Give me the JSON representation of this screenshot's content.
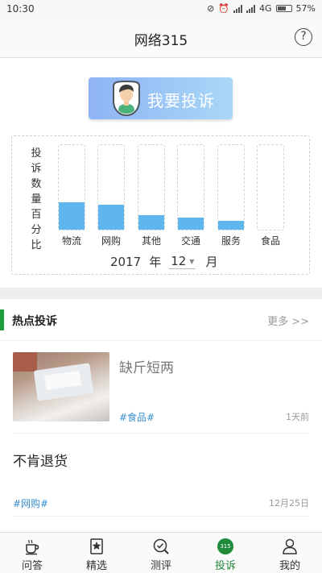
{
  "status_bar": {
    "time": "10:30",
    "network": "4G",
    "battery": "57%"
  },
  "header": {
    "title": "网络315",
    "help_icon": "question-circle-icon"
  },
  "complain_button": {
    "label": "我要投诉",
    "icon": "user-avatar-icon"
  },
  "chart": {
    "ylabel_chars": [
      "投",
      "诉",
      "数",
      "量",
      "百",
      "分",
      "比"
    ],
    "year": "2017",
    "year_unit": "年",
    "month": "12",
    "month_unit": "月"
  },
  "chart_data": {
    "type": "bar",
    "categories": [
      "物流",
      "网购",
      "其他",
      "交通",
      "服务",
      "食品"
    ],
    "values": [
      32,
      29,
      17,
      14,
      10,
      0
    ],
    "ylabel": "投诉数量百分比",
    "ylim": [
      0,
      100
    ],
    "grid": false,
    "bar_color": "#5fb6ec"
  },
  "hot": {
    "title": "热点投诉",
    "more": "更多 >>",
    "accent_color": "#1f9a3c",
    "items": [
      {
        "title": "缺斤短两",
        "tag": "#食品#",
        "time": "1天前",
        "has_image": true
      },
      {
        "title": "不肯退货",
        "tag": "#网购#",
        "time": "12月25日",
        "has_image": false
      }
    ]
  },
  "nav": {
    "active_color": "#1f8a3a",
    "items": [
      {
        "label": "问答",
        "icon": "coffee-cup-icon"
      },
      {
        "label": "精选",
        "icon": "star-bookmark-icon"
      },
      {
        "label": "测评",
        "icon": "search-review-icon"
      },
      {
        "label": "投诉",
        "icon": "badge-315-icon",
        "badge": "315"
      },
      {
        "label": "我的",
        "icon": "person-icon"
      }
    ]
  }
}
